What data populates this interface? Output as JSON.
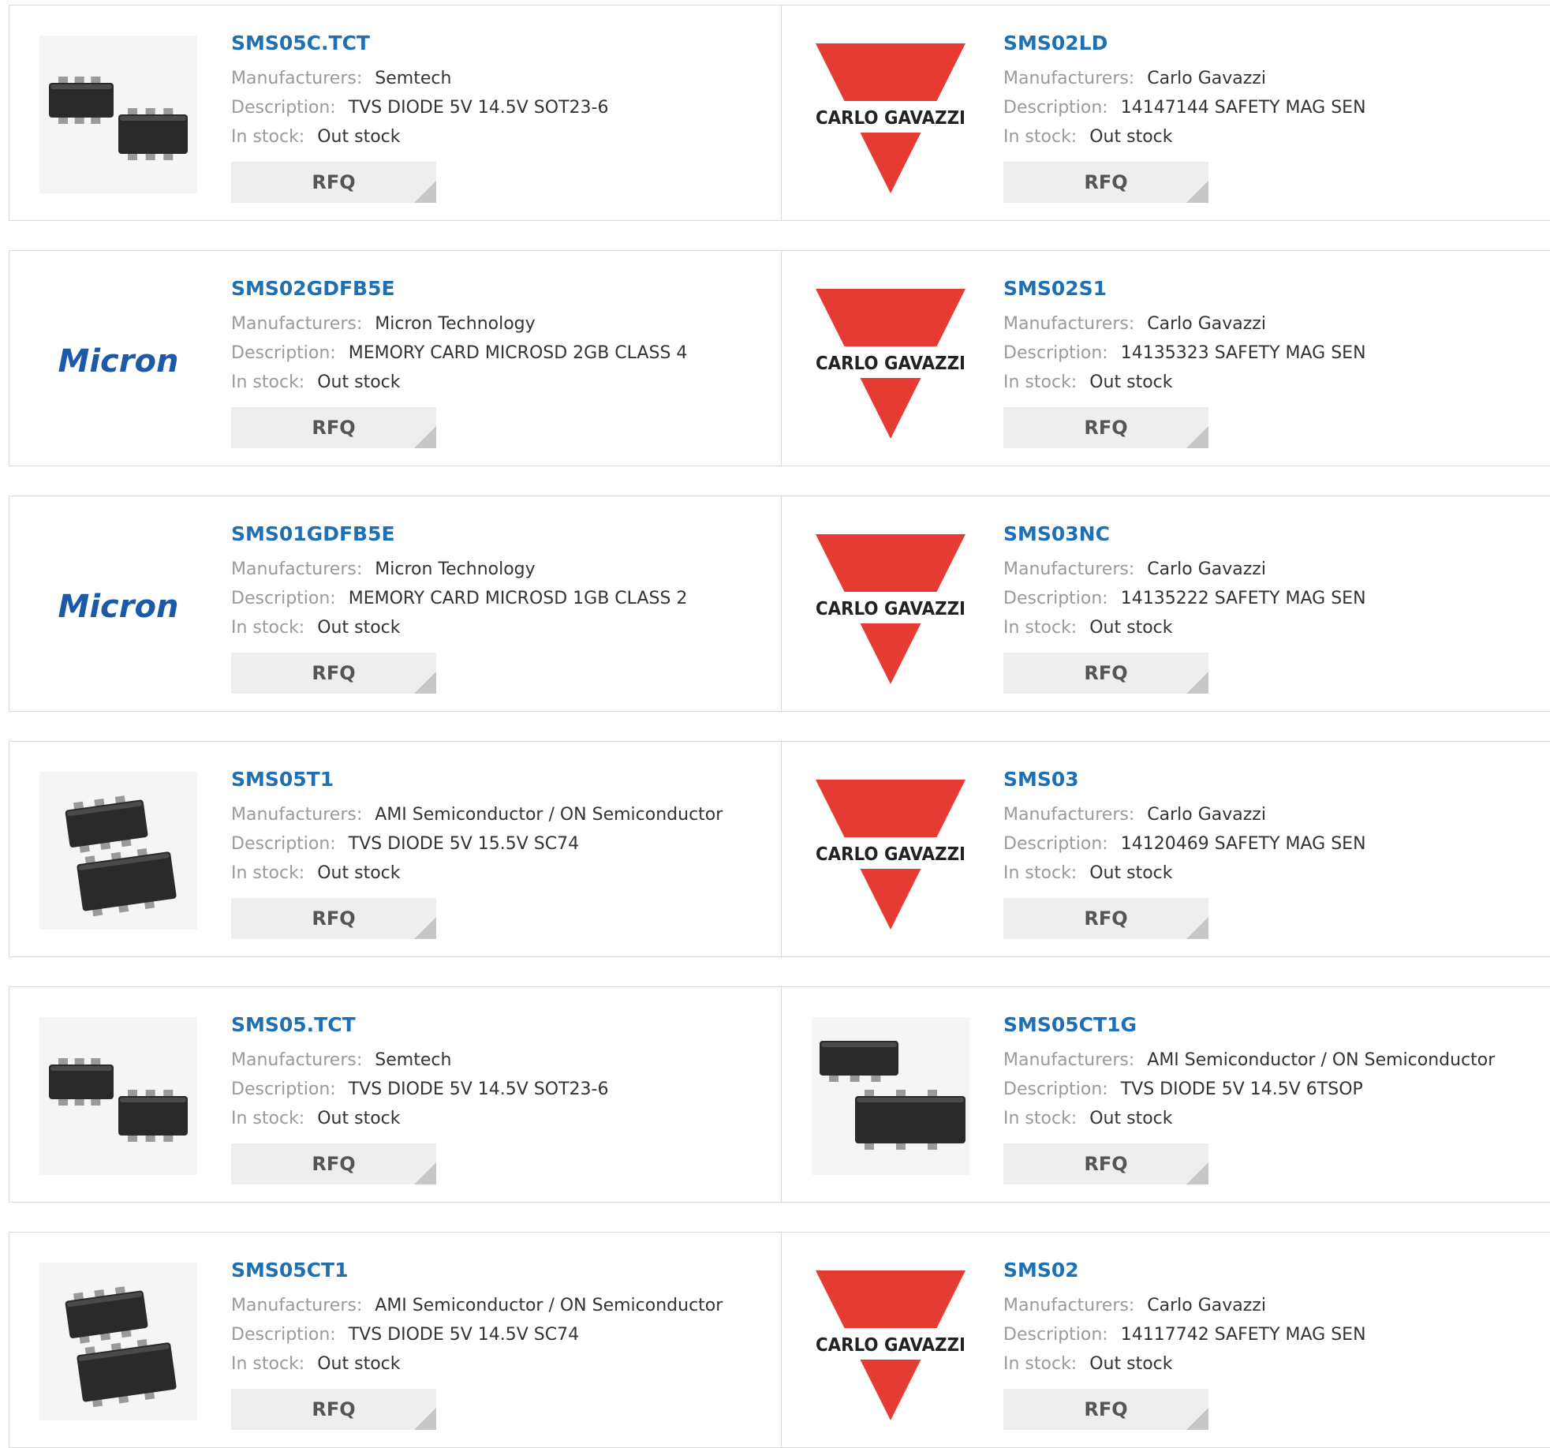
{
  "labels": {
    "manufacturers": "Manufacturers:",
    "description": "Description:",
    "in_stock": "In stock:",
    "rfq": "RFQ"
  },
  "brand_colors": {
    "title_link": "#1f6fb5",
    "carlo_gavazzi_red": "#e63b32",
    "micron_blue": "#1a5aa8"
  },
  "rows": [
    {
      "left": {
        "part": "SMS05C.TCT",
        "manufacturer": "Semtech",
        "description": "TVS DIODE 5V 14.5V SOT23-6",
        "stock": "Out stock",
        "image": "sot23-6-chip-icon"
      },
      "right": {
        "part": "SMS02LD",
        "manufacturer": "Carlo Gavazzi",
        "description": "14147144 SAFETY MAG SEN",
        "stock": "Out stock",
        "image": "carlo-gavazzi-logo",
        "logo_text": "CARLO GAVAZZI"
      }
    },
    {
      "left": {
        "part": "SMS02GDFB5E",
        "manufacturer": "Micron Technology",
        "description": "MEMORY CARD MICROSD 2GB CLASS 4",
        "stock": "Out stock",
        "image": "micron-logo",
        "logo_text": "Micron"
      },
      "right": {
        "part": "SMS02S1",
        "manufacturer": "Carlo Gavazzi",
        "description": "14135323 SAFETY MAG SEN",
        "stock": "Out stock",
        "image": "carlo-gavazzi-logo",
        "logo_text": "CARLO GAVAZZI"
      }
    },
    {
      "left": {
        "part": "SMS01GDFB5E",
        "manufacturer": "Micron Technology",
        "description": "MEMORY CARD MICROSD 1GB CLASS 2",
        "stock": "Out stock",
        "image": "micron-logo",
        "logo_text": "Micron"
      },
      "right": {
        "part": "SMS03NC",
        "manufacturer": "Carlo Gavazzi",
        "description": "14135222 SAFETY MAG SEN",
        "stock": "Out stock",
        "image": "carlo-gavazzi-logo",
        "logo_text": "CARLO GAVAZZI"
      }
    },
    {
      "left": {
        "part": "SMS05T1",
        "manufacturer": "AMI Semiconductor / ON Semiconductor",
        "description": "TVS DIODE 5V 15.5V SC74",
        "stock": "Out stock",
        "image": "sc74-chip-icon"
      },
      "right": {
        "part": "SMS03",
        "manufacturer": "Carlo Gavazzi",
        "description": "14120469 SAFETY MAG SEN",
        "stock": "Out stock",
        "image": "carlo-gavazzi-logo",
        "logo_text": "CARLO GAVAZZI"
      }
    },
    {
      "left": {
        "part": "SMS05.TCT",
        "manufacturer": "Semtech",
        "description": "TVS DIODE 5V 14.5V SOT23-6",
        "stock": "Out stock",
        "image": "sot23-6-chip-icon"
      },
      "right": {
        "part": "SMS05CT1G",
        "manufacturer": "AMI Semiconductor / ON Semiconductor",
        "description": "TVS DIODE 5V 14.5V 6TSOP",
        "stock": "Out stock",
        "image": "tsop6-chip-icon"
      }
    },
    {
      "left": {
        "part": "SMS05CT1",
        "manufacturer": "AMI Semiconductor / ON Semiconductor",
        "description": "TVS DIODE 5V 14.5V SC74",
        "stock": "Out stock",
        "image": "sc74-chip-icon"
      },
      "right": {
        "part": "SMS02",
        "manufacturer": "Carlo Gavazzi",
        "description": "14117742 SAFETY MAG SEN",
        "stock": "Out stock",
        "image": "carlo-gavazzi-logo",
        "logo_text": "CARLO GAVAZZI"
      }
    }
  ]
}
